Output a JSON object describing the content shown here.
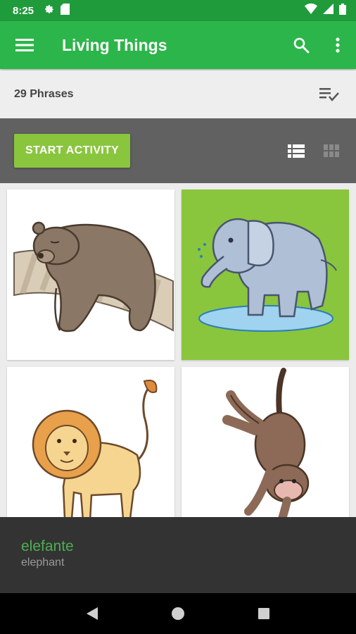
{
  "status_bar": {
    "time": "8:25",
    "left_icons": [
      "settings-icon",
      "sd-card-icon"
    ],
    "right_icons": [
      "wifi-icon",
      "signal-icon",
      "battery-icon"
    ]
  },
  "app_bar": {
    "title": "Living Things",
    "color": "#2cb54a",
    "menu_icon": "hamburger-menu-icon",
    "actions": [
      "search-icon",
      "more-vert-icon"
    ]
  },
  "phrases_bar": {
    "count_label": "29 Phrases",
    "sort_icon": "playlist-check-icon"
  },
  "activity_bar": {
    "start_label": "START ACTIVITY",
    "accent": "#8ac53e",
    "views": [
      "list-view-icon",
      "grid-view-icon"
    ],
    "active_view": "list-view-icon"
  },
  "grid": {
    "cards": [
      {
        "name": "bear",
        "selected": false
      },
      {
        "name": "elephant",
        "selected": true
      },
      {
        "name": "lion",
        "selected": false
      },
      {
        "name": "monkey",
        "selected": false
      }
    ]
  },
  "phrase_panel": {
    "target": "elefante",
    "native": "elephant"
  },
  "nav_bar": {
    "buttons": [
      "back-icon",
      "home-icon",
      "recents-icon"
    ]
  }
}
